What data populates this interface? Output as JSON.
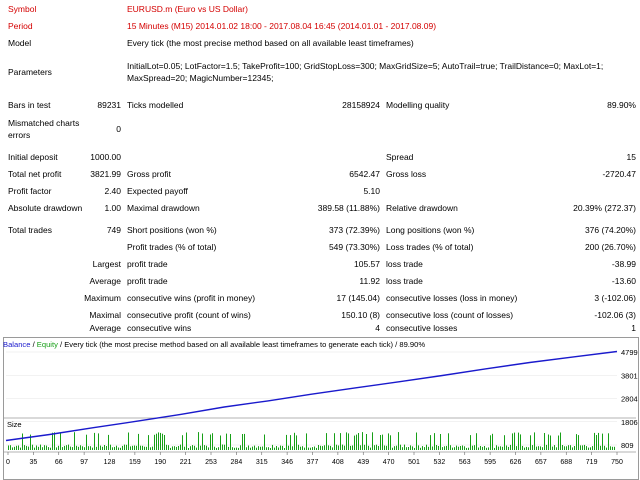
{
  "symbol": {
    "label": "Symbol",
    "value": "EURUSD.m (Euro vs US Dollar)"
  },
  "period": {
    "label": "Period",
    "value": "15 Minutes (M15) 2014.01.02 18:00 - 2017.08.04 16:45 (2014.01.01 - 2017.08.09)"
  },
  "model": {
    "label": "Model",
    "value": "Every tick (the most precise method based on all available least timeframes)"
  },
  "parameters": {
    "label": "Parameters",
    "line1": "InitialLot=0.05; LotFactor=1.5; TakeProfit=100; GridStopLoss=300; MaxGridSize=5; AutoTrail=true; TrailDistance=0; MaxLot=1;",
    "line2": "MaxSpread=20; MagicNumber=12345;"
  },
  "bars": {
    "label": "Bars in test",
    "value": "89231",
    "ticks_label": "Ticks modelled",
    "ticks_value": "28158924",
    "quality_label": "Modelling quality",
    "quality_value": "89.90%"
  },
  "mismatch": {
    "label1": "Mismatched charts",
    "label2": "errors",
    "value": "0"
  },
  "deposit": {
    "label": "Initial deposit",
    "value": "1000.00",
    "spread_label": "Spread",
    "spread_value": "15"
  },
  "netprofit": {
    "label": "Total net profit",
    "value": "3821.99",
    "gp_label": "Gross profit",
    "gp_value": "6542.47",
    "gl_label": "Gross loss",
    "gl_value": "-2720.47"
  },
  "pf": {
    "label": "Profit factor",
    "value": "2.40",
    "ep_label": "Expected payoff",
    "ep_value": "5.10"
  },
  "dd": {
    "label": "Absolute drawdown",
    "value": "1.00",
    "max_label": "Maximal drawdown",
    "max_value": "389.58 (11.88%)",
    "rel_label": "Relative drawdown",
    "rel_value": "20.39% (272.37)"
  },
  "trades": {
    "label": "Total trades",
    "value": "749",
    "short_label": "Short positions (won %)",
    "short_value": "373 (72.39%)",
    "long_label": "Long positions (won %)",
    "long_value": "376 (74.20%)"
  },
  "pt": {
    "label": "Profit trades (% of total)",
    "value": "549 (73.30%)",
    "lt_label": "Loss trades (% of total)",
    "lt_value": "200 (26.70%)"
  },
  "largest": {
    "label": "Largest",
    "pt_label": "profit trade",
    "pt_value": "105.57",
    "lt_label": "loss trade",
    "lt_value": "-38.99"
  },
  "average": {
    "label": "Average",
    "pt_label": "profit trade",
    "pt_value": "11.92",
    "lt_label": "loss trade",
    "lt_value": "-13.60"
  },
  "maximum": {
    "label": "Maximum",
    "w_label": "consecutive wins (profit in money)",
    "w_value": "17 (145.04)",
    "l_label": "consecutive losses (loss in money)",
    "l_value": "3 (-102.06)"
  },
  "maximal": {
    "label": "Maximal",
    "w_label": "consecutive profit (count of wins)",
    "w_value": "150.10 (8)",
    "l_label": "consecutive loss (count of losses)",
    "l_value": "-102.06 (3)"
  },
  "average2": {
    "label": "Average",
    "w_label": "consecutive wins",
    "w_value": "4",
    "l_label": "consecutive losses",
    "l_value": "1"
  },
  "chart": {
    "legend_balance": "Balance",
    "legend_sep": " / ",
    "legend_equity": "Equity",
    "legend_rest": " / Every tick (the most precise method based on all available least timeframes to generate each tick) / 89.90%",
    "size_label": "Size",
    "colors": {
      "balance": "#1a1acc",
      "equity": "#18a018",
      "size": "#18a018"
    }
  },
  "chart_data": {
    "type": "line",
    "series": [
      {
        "name": "Balance",
        "values": [
          1000,
          1260,
          1550,
          1830,
          2120,
          2440,
          2700,
          2990,
          3260,
          3520,
          3790,
          4080,
          4350,
          4590,
          4821.99
        ]
      }
    ],
    "y_ticks": [
      "4799",
      "3801",
      "2804",
      "1806",
      "809"
    ],
    "ylim": [
      809,
      4799
    ],
    "x_ticks": [
      "0",
      "35",
      "66",
      "97",
      "128",
      "159",
      "190",
      "221",
      "253",
      "284",
      "315",
      "346",
      "377",
      "408",
      "439",
      "470",
      "501",
      "532",
      "563",
      "595",
      "626",
      "657",
      "688",
      "719",
      "750"
    ],
    "xlim": [
      0,
      749
    ]
  }
}
